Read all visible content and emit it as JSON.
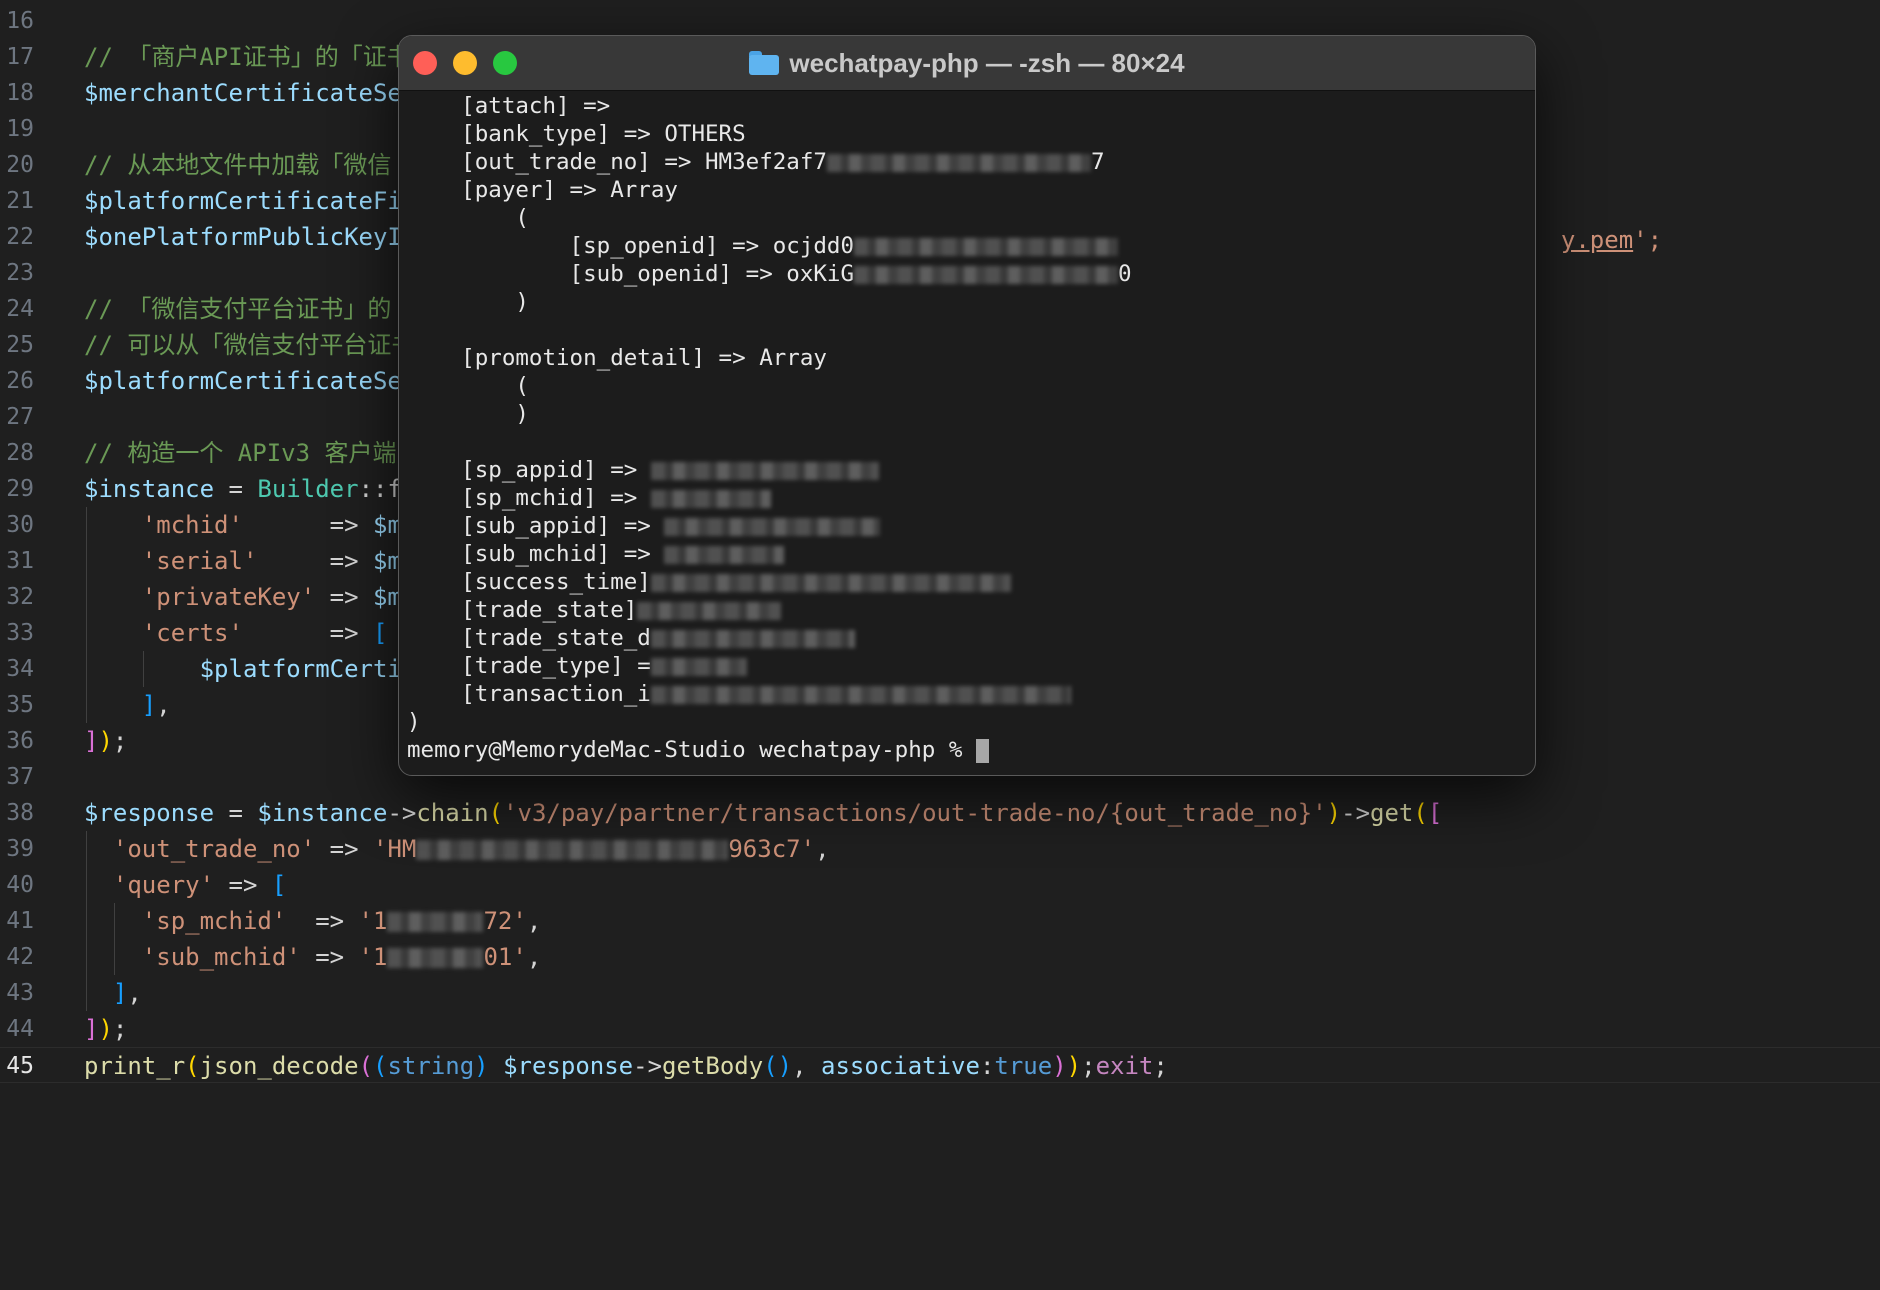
{
  "editor": {
    "active_line": "45",
    "lines": [
      {
        "num": "16",
        "parts": []
      },
      {
        "num": "17",
        "parts": [
          {
            "t": "// 「商户API证书」的「证书",
            "c": "c-comment"
          }
        ]
      },
      {
        "num": "18",
        "parts": [
          {
            "t": "$merchantCertificateSe",
            "c": "c-var"
          }
        ]
      },
      {
        "num": "19",
        "parts": []
      },
      {
        "num": "20",
        "parts": [
          {
            "t": "// 从本地文件中加载「微信",
            "c": "c-comment"
          }
        ]
      },
      {
        "num": "21",
        "parts": [
          {
            "t": "$platformCertificateFi",
            "c": "c-var"
          }
        ]
      },
      {
        "num": "22",
        "parts": [
          {
            "t": "$onePlatformPublicKeyI",
            "c": "c-var"
          }
        ]
      },
      {
        "num": "23",
        "parts": []
      },
      {
        "num": "24",
        "parts": [
          {
            "t": "// 「微信支付平台证书」的",
            "c": "c-comment"
          }
        ]
      },
      {
        "num": "25",
        "parts": [
          {
            "t": "// 可以从「微信支付平台证书",
            "c": "c-comment"
          }
        ]
      },
      {
        "num": "26",
        "parts": [
          {
            "t": "$platformCertificateSe",
            "c": "c-var"
          }
        ]
      },
      {
        "num": "27",
        "parts": []
      },
      {
        "num": "28",
        "parts": [
          {
            "t": "// 构造一个 APIv3 客户端",
            "c": "c-comment"
          }
        ]
      },
      {
        "num": "29",
        "parts": [
          {
            "t": "$instance",
            "c": "c-var"
          },
          {
            "t": " = ",
            "c": "c-op"
          },
          {
            "t": "Builder",
            "c": "c-cls"
          },
          {
            "t": "::f",
            "c": "c-op"
          }
        ]
      },
      {
        "num": "30",
        "parts": [
          {
            "t": "    ",
            "c": "c-op"
          },
          {
            "t": "'mchid'",
            "c": "c-str"
          },
          {
            "t": "      => ",
            "c": "c-op"
          },
          {
            "t": "$m",
            "c": "c-var"
          }
        ]
      },
      {
        "num": "31",
        "parts": [
          {
            "t": "    ",
            "c": "c-op"
          },
          {
            "t": "'serial'",
            "c": "c-str"
          },
          {
            "t": "     => ",
            "c": "c-op"
          },
          {
            "t": "$m",
            "c": "c-var"
          }
        ]
      },
      {
        "num": "32",
        "parts": [
          {
            "t": "    ",
            "c": "c-op"
          },
          {
            "t": "'privateKey'",
            "c": "c-str"
          },
          {
            "t": " => ",
            "c": "c-op"
          },
          {
            "t": "$m",
            "c": "c-var"
          }
        ]
      },
      {
        "num": "33",
        "parts": [
          {
            "t": "    ",
            "c": "c-op"
          },
          {
            "t": "'certs'",
            "c": "c-str"
          },
          {
            "t": "      => ",
            "c": "c-op"
          },
          {
            "t": "[",
            "c": "c-br3"
          }
        ]
      },
      {
        "num": "34",
        "parts": [
          {
            "t": "        ",
            "c": "c-op"
          },
          {
            "t": "$platformCerti",
            "c": "c-var"
          }
        ]
      },
      {
        "num": "35",
        "parts": [
          {
            "t": "    ",
            "c": "c-op"
          },
          {
            "t": "]",
            "c": "c-br3"
          },
          {
            "t": ",",
            "c": "c-op"
          }
        ]
      },
      {
        "num": "36",
        "parts": [
          {
            "t": "]",
            "c": "c-br2"
          },
          {
            "t": ")",
            "c": "c-br1"
          },
          {
            "t": ";",
            "c": "c-op"
          }
        ]
      },
      {
        "num": "37",
        "parts": []
      },
      {
        "num": "38",
        "parts": [
          {
            "t": "$response",
            "c": "c-var"
          },
          {
            "t": " = ",
            "c": "c-op"
          },
          {
            "t": "$instance",
            "c": "c-var"
          },
          {
            "t": "->",
            "c": "c-op"
          },
          {
            "t": "chain",
            "c": "c-fn"
          },
          {
            "t": "(",
            "c": "c-br1"
          },
          {
            "t": "'v3/pay/partner/transactions/out-trade-no/{out_trade_no}'",
            "c": "c-str"
          },
          {
            "t": ")",
            "c": "c-br1"
          },
          {
            "t": "->",
            "c": "c-op"
          },
          {
            "t": "get",
            "c": "c-fn"
          },
          {
            "t": "(",
            "c": "c-br1"
          },
          {
            "t": "[",
            "c": "c-br2"
          }
        ]
      },
      {
        "num": "39",
        "parts": [
          {
            "t": "  ",
            "c": "c-op"
          },
          {
            "t": "'out_trade_no'",
            "c": "c-str"
          },
          {
            "t": " => ",
            "c": "c-op"
          },
          {
            "t": "'HM",
            "c": "c-str"
          },
          {
            "blur": 26
          },
          {
            "t": "963c7'",
            "c": "c-str"
          },
          {
            "t": ",",
            "c": "c-op"
          }
        ]
      },
      {
        "num": "40",
        "parts": [
          {
            "t": "  ",
            "c": "c-op"
          },
          {
            "t": "'query'",
            "c": "c-str"
          },
          {
            "t": " => ",
            "c": "c-op"
          },
          {
            "t": "[",
            "c": "c-br3"
          }
        ]
      },
      {
        "num": "41",
        "parts": [
          {
            "t": "    ",
            "c": "c-op"
          },
          {
            "t": "'sp_mchid'",
            "c": "c-str"
          },
          {
            "t": "  => ",
            "c": "c-op"
          },
          {
            "t": "'1",
            "c": "c-str"
          },
          {
            "blur": 8
          },
          {
            "t": "72'",
            "c": "c-str"
          },
          {
            "t": ",",
            "c": "c-op"
          }
        ]
      },
      {
        "num": "42",
        "parts": [
          {
            "t": "    ",
            "c": "c-op"
          },
          {
            "t": "'sub_mchid'",
            "c": "c-str"
          },
          {
            "t": " => ",
            "c": "c-op"
          },
          {
            "t": "'1",
            "c": "c-str"
          },
          {
            "blur": 8
          },
          {
            "t": "01'",
            "c": "c-str"
          },
          {
            "t": ",",
            "c": "c-op"
          }
        ]
      },
      {
        "num": "43",
        "parts": [
          {
            "t": "  ",
            "c": "c-op"
          },
          {
            "t": "]",
            "c": "c-br3"
          },
          {
            "t": ",",
            "c": "c-op"
          }
        ]
      },
      {
        "num": "44",
        "parts": [
          {
            "t": "]",
            "c": "c-br2"
          },
          {
            "t": ")",
            "c": "c-br1"
          },
          {
            "t": ";",
            "c": "c-op"
          }
        ]
      },
      {
        "num": "45",
        "parts": [
          {
            "t": "print_r",
            "c": "c-fn"
          },
          {
            "t": "(",
            "c": "c-br1"
          },
          {
            "t": "json_decode",
            "c": "c-fn"
          },
          {
            "t": "(",
            "c": "c-br2"
          },
          {
            "t": "(",
            "c": "c-br3"
          },
          {
            "t": "string",
            "c": "c-kw"
          },
          {
            "t": ") ",
            "c": "c-br3"
          },
          {
            "t": "$response",
            "c": "c-var"
          },
          {
            "t": "->",
            "c": "c-op"
          },
          {
            "t": "getBody",
            "c": "c-fn"
          },
          {
            "t": "()",
            "c": "c-br3"
          },
          {
            "t": ", ",
            "c": "c-op"
          },
          {
            "t": "associative",
            "c": "c-var"
          },
          {
            "t": ":",
            "c": "c-op"
          },
          {
            "t": "true",
            "c": "c-kw"
          },
          {
            "t": ")",
            "c": "c-br2"
          },
          {
            "t": ")",
            "c": "c-br1"
          },
          {
            "t": ";",
            "c": "c-op"
          },
          {
            "t": "exit",
            "c": "c-ctl"
          },
          {
            "t": ";",
            "c": "c-op"
          }
        ]
      }
    ],
    "right_fragment_link": "y.pem",
    "right_fragment_rest": "';"
  },
  "terminal": {
    "title": "wechatpay-php — -zsh — 80×24",
    "lines": [
      {
        "parts": [
          {
            "t": "    [attach] =>"
          }
        ]
      },
      {
        "parts": [
          {
            "t": "    [bank_type] => OTHERS"
          }
        ]
      },
      {
        "parts": [
          {
            "t": "    [out_trade_no] => HM3ef2af7"
          },
          {
            "blur": 22
          },
          {
            "t": "7"
          }
        ]
      },
      {
        "parts": [
          {
            "t": "    [payer] => Array"
          }
        ]
      },
      {
        "parts": [
          {
            "t": "        ("
          }
        ]
      },
      {
        "parts": [
          {
            "t": "            [sp_openid] => ocjdd0"
          },
          {
            "blur": 22
          }
        ]
      },
      {
        "parts": [
          {
            "t": "            [sub_openid] => oxKiG"
          },
          {
            "blur": 22
          },
          {
            "t": "0"
          }
        ]
      },
      {
        "parts": [
          {
            "t": "        )"
          }
        ]
      },
      {
        "parts": []
      },
      {
        "parts": [
          {
            "t": "    [promotion_detail] => Array"
          }
        ]
      },
      {
        "parts": [
          {
            "t": "        ("
          }
        ]
      },
      {
        "parts": [
          {
            "t": "        )"
          }
        ]
      },
      {
        "parts": []
      },
      {
        "parts": [
          {
            "t": "    [sp_appid] => "
          },
          {
            "blur": 19
          }
        ]
      },
      {
        "parts": [
          {
            "t": "    [sp_mchid] => "
          },
          {
            "blur": 10
          }
        ]
      },
      {
        "parts": [
          {
            "t": "    [sub_appid] => "
          },
          {
            "blur": 18
          }
        ]
      },
      {
        "parts": [
          {
            "t": "    [sub_mchid] => "
          },
          {
            "blur": 10
          }
        ]
      },
      {
        "parts": [
          {
            "t": "    [success_time]"
          },
          {
            "blur": 30
          }
        ]
      },
      {
        "parts": [
          {
            "t": "    [trade_state]"
          },
          {
            "blur": 12
          }
        ]
      },
      {
        "parts": [
          {
            "t": "    [trade_state_d"
          },
          {
            "blur": 17
          }
        ]
      },
      {
        "parts": [
          {
            "t": "    [trade_type] ="
          },
          {
            "blur": 8
          }
        ]
      },
      {
        "parts": [
          {
            "t": "    [transaction_i"
          },
          {
            "blur": 35
          }
        ]
      },
      {
        "parts": [
          {
            "t": ")"
          }
        ]
      },
      {
        "parts": [
          {
            "t": "memory@MemorydeMac-Studio wechatpay-php % "
          },
          {
            "cursor": true
          }
        ]
      }
    ]
  },
  "colors": {
    "close": "#ff5f57",
    "minimize": "#febc2e",
    "zoom": "#28c840"
  }
}
